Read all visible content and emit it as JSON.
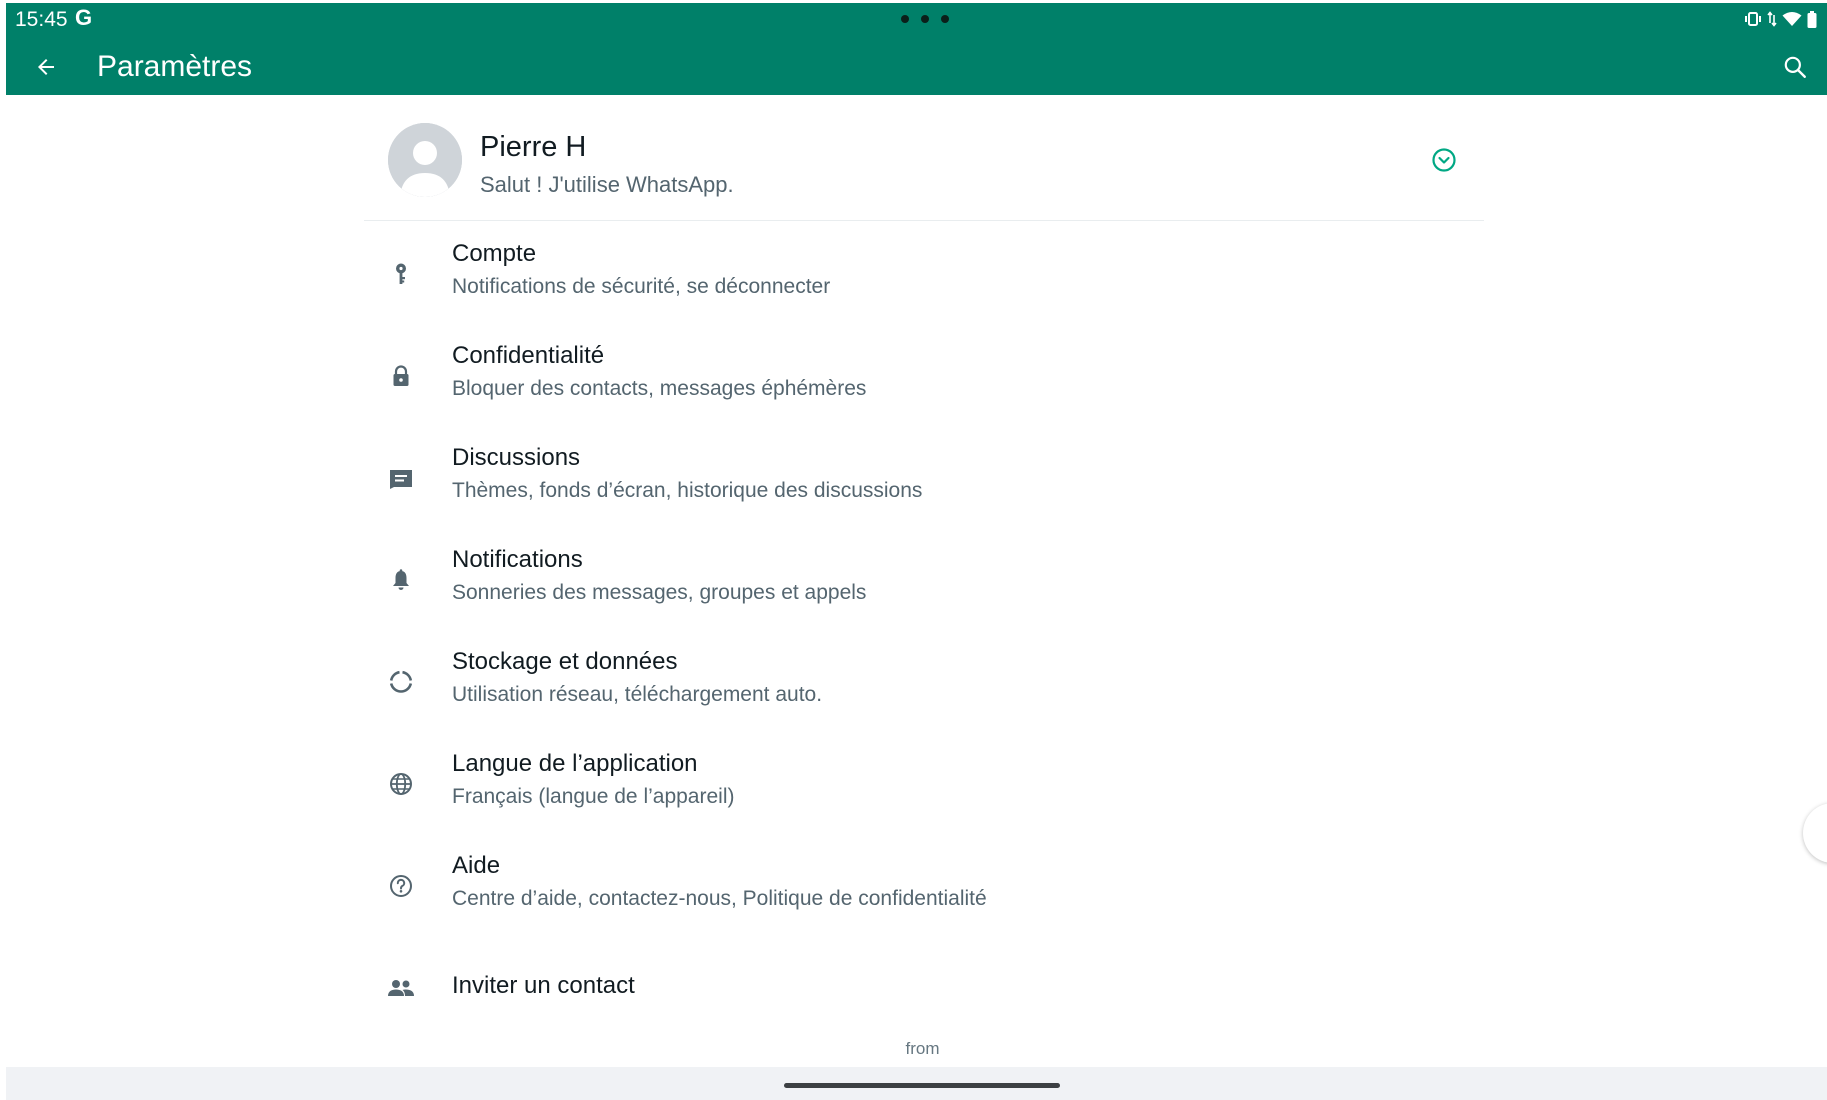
{
  "status_bar": {
    "time": "15:45",
    "carrier_icon_text": "G",
    "icons": [
      "vibrate-icon",
      "data-arrows-icon",
      "wifi-icon",
      "battery-icon"
    ]
  },
  "toolbar": {
    "title": "Paramètres",
    "back_icon": "arrow-left-icon",
    "search_icon": "search-icon",
    "color": "#008069"
  },
  "profile": {
    "name": "Pierre H",
    "about": "Salut ! J'utilise WhatsApp.",
    "qr_icon": "chevron-circle-down-icon",
    "accent": "#00a884"
  },
  "menu": [
    {
      "icon": "key-icon",
      "title": "Compte",
      "subtitle": "Notifications de sécurité, se déconnecter"
    },
    {
      "icon": "lock-icon",
      "title": "Confidentialité",
      "subtitle": "Bloquer des contacts, messages éphémères"
    },
    {
      "icon": "chat-icon",
      "title": "Discussions",
      "subtitle": "Thèmes, fonds d’écran, historique des discussions"
    },
    {
      "icon": "bell-icon",
      "title": "Notifications",
      "subtitle": "Sonneries des messages, groupes et appels"
    },
    {
      "icon": "data-usage-icon",
      "title": "Stockage et données",
      "subtitle": "Utilisation réseau, téléchargement auto."
    },
    {
      "icon": "globe-icon",
      "title": "Langue de l’application",
      "subtitle": "Français (langue de l’appareil)"
    },
    {
      "icon": "help-icon",
      "title": "Aide",
      "subtitle": "Centre d’aide, contactez-nous, Politique de confidentialité"
    },
    {
      "icon": "people-icon",
      "title": "Inviter un contact"
    }
  ],
  "footer": {
    "from": "from"
  }
}
